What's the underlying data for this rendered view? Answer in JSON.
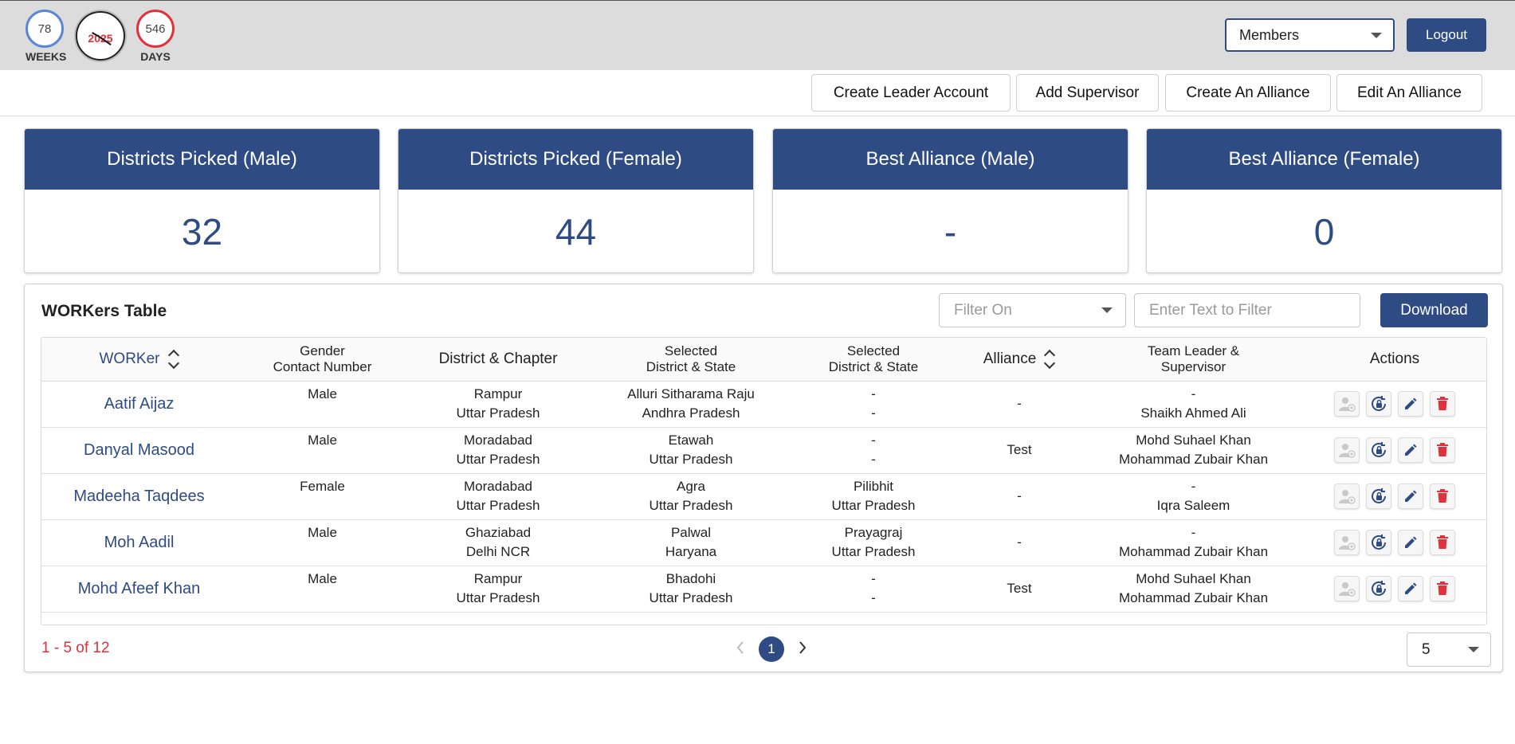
{
  "header": {
    "weeks": {
      "value": "78",
      "label": "WEEKS"
    },
    "clock": {
      "year": "2025"
    },
    "days": {
      "value": "546",
      "label": "DAYS"
    },
    "members_select": "Members",
    "logout_label": "Logout"
  },
  "actions": {
    "create_leader": "Create Leader Account",
    "add_supervisor": "Add Supervisor",
    "create_alliance": "Create An Alliance",
    "edit_alliance": "Edit An Alliance"
  },
  "stats": [
    {
      "title": "Districts Picked (Male)",
      "value": "32"
    },
    {
      "title": "Districts Picked (Female)",
      "value": "44"
    },
    {
      "title": "Best Alliance (Male)",
      "value": "-"
    },
    {
      "title": "Best Alliance (Female)",
      "value": "0"
    }
  ],
  "table_panel": {
    "title": "WORKers Table",
    "filter_placeholder": "Filter On",
    "filter_text_placeholder": "Enter Text to Filter",
    "download_label": "Download",
    "columns": {
      "worker": "WORKer",
      "gender_1": "Gender",
      "gender_2": "Contact Number",
      "district": "District & Chapter",
      "sel1_1": "Selected",
      "sel1_2": "District & State",
      "sel2_1": "Selected",
      "sel2_2": "District & State",
      "alliance": "Alliance",
      "team_1": "Team Leader &",
      "team_2": "Supervisor",
      "actions": "Actions"
    },
    "rows": [
      {
        "name": "Aatif Aijaz",
        "gender": "Male",
        "district": "Rampur",
        "chapter": "Uttar Pradesh",
        "sel1_district": "Alluri Sitharama Raju",
        "sel1_state": "Andhra Pradesh",
        "sel2_district": "-",
        "sel2_state": "-",
        "alliance": "-",
        "leader": "-",
        "supervisor": "Shaikh Ahmed Ali"
      },
      {
        "name": "Danyal Masood",
        "gender": "Male",
        "district": "Moradabad",
        "chapter": "Uttar Pradesh",
        "sel1_district": "Etawah",
        "sel1_state": "Uttar Pradesh",
        "sel2_district": "-",
        "sel2_state": "-",
        "alliance": "Test",
        "leader": "Mohd Suhael Khan",
        "supervisor": "Mohammad Zubair Khan"
      },
      {
        "name": "Madeeha Taqdees",
        "gender": "Female",
        "district": "Moradabad",
        "chapter": "Uttar Pradesh",
        "sel1_district": "Agra",
        "sel1_state": "Uttar Pradesh",
        "sel2_district": "Pilibhit",
        "sel2_state": "Uttar Pradesh",
        "alliance": "-",
        "leader": "-",
        "supervisor": "Iqra Saleem"
      },
      {
        "name": "Moh Aadil",
        "gender": "Male",
        "district": "Ghaziabad",
        "chapter": "Delhi NCR",
        "sel1_district": "Palwal",
        "sel1_state": "Haryana",
        "sel2_district": "Prayagraj",
        "sel2_state": "Uttar Pradesh",
        "alliance": "-",
        "leader": "-",
        "supervisor": "Mohammad Zubair Khan"
      },
      {
        "name": "Mohd Afeef Khan",
        "gender": "Male",
        "district": "Rampur",
        "chapter": "Uttar Pradesh",
        "sel1_district": "Bhadohi",
        "sel1_state": "Uttar Pradesh",
        "sel2_district": "-",
        "sel2_state": "-",
        "alliance": "Test",
        "leader": "Mohd Suhael Khan",
        "supervisor": "Mohammad Zubair Khan"
      }
    ],
    "pagination": {
      "range_text": "1 - 5 of 12",
      "current_page": "1",
      "rows_per_page": "5"
    }
  },
  "colors": {
    "primary": "#2f4b84",
    "danger": "#e0323c",
    "weeks_ring": "#5a86d6",
    "topbar_bg": "#dcdcdc"
  },
  "icons": [
    "person-add-icon",
    "lock-reset-icon",
    "edit-pencil-icon",
    "delete-trash-icon",
    "chevron-left-icon",
    "chevron-right-icon",
    "sort-icon",
    "caret-down-icon"
  ]
}
